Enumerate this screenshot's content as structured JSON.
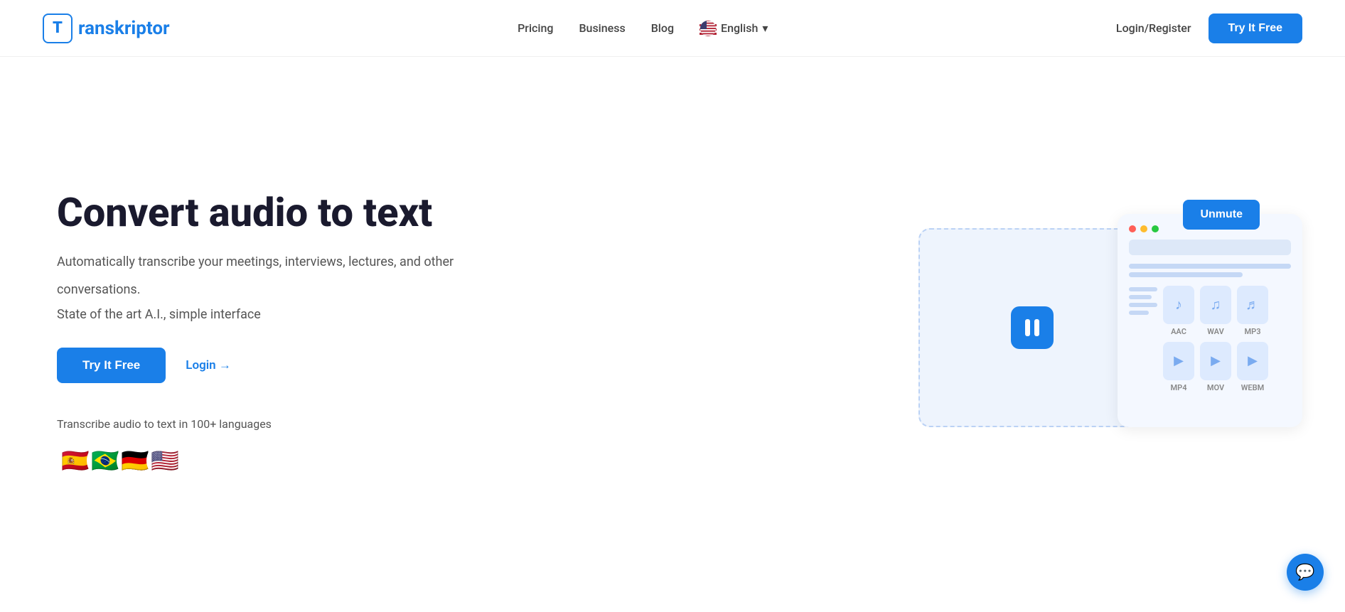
{
  "header": {
    "logo_letter": "T",
    "logo_text": "ranskriptor",
    "nav": {
      "pricing": "Pricing",
      "business": "Business",
      "blog": "Blog",
      "language": "English",
      "login_register": "Login/Register",
      "try_btn": "Try It Free"
    }
  },
  "hero": {
    "title": "Convert audio to text",
    "subtitle1": "Automatically transcribe your meetings, interviews, lectures, and other",
    "subtitle2": "conversations.",
    "subtitle3": "State of the art A.I., simple interface",
    "try_btn": "Try It Free",
    "login_link": "Login →",
    "lang_label": "Transcribe audio to text in 100+ languages",
    "flags": [
      "🇪🇸",
      "🇧🇷",
      "🇩🇪",
      "🇺🇸"
    ]
  },
  "demo": {
    "unmute_btn": "Unmute",
    "formats": [
      "AAC",
      "WAV",
      "MP3",
      "MP4",
      "MOV",
      "WEBM"
    ]
  },
  "chat": {
    "icon": "💬"
  }
}
